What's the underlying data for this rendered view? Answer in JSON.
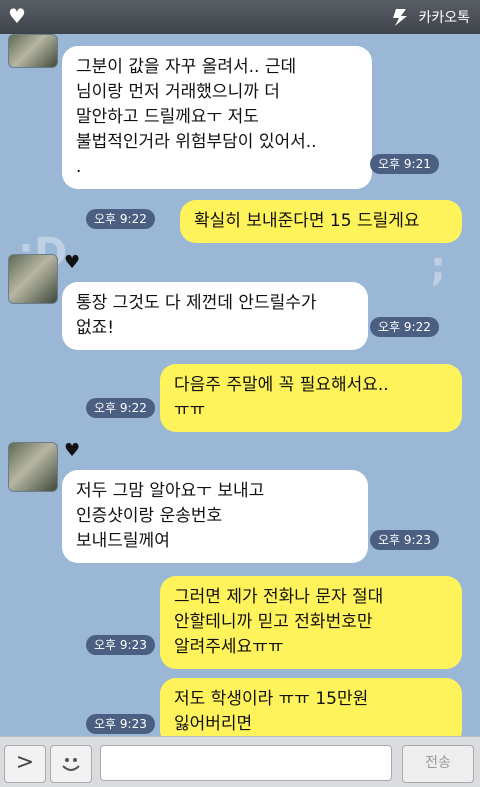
{
  "app": {
    "brand": "카카오톡"
  },
  "messages": [
    {
      "text": "그분이 값을 자꾸 올려서.. 근데\n님이랑 먼저 거래했으니까 더\n말안하고 드릴께요ㅜ 저도\n불법적인거라 위험부담이 있어서..\n.",
      "time": "오후 9:21"
    },
    {
      "text": "확실히 보내준다면 15 드릴게요",
      "time": "오후 9:22"
    },
    {
      "text": "통장 그것도 다 제껀데 안드릴수가\n없죠!",
      "time": "오후 9:22"
    },
    {
      "text": "다음주 주말에 꼭 필요해서요..\nㅠㅠ",
      "time": "오후 9:22"
    },
    {
      "text": "저두 그맘 알아요ㅜ 보내고\n인증샷이랑 운송번호\n보내드릴께여",
      "time": "오후 9:23"
    },
    {
      "text": "그러면 제가 전화나 문자 절대\n안할테니까 믿고 전화번호만\n알려주세요ㅠㅠ",
      "time": "오후 9:23"
    },
    {
      "text": "저도 학생이라 ㅠㅠ 15만원\n잃어버리면",
      "time": "오후 9:23"
    }
  ],
  "input": {
    "send_label": "전송"
  },
  "icons": [
    "heart-icon",
    "kakao-logo-icon",
    "chevron-right-icon",
    "smiley-icon"
  ],
  "colors": {
    "chat_bg": "#9bb7d6",
    "my_bubble": "#fff35c",
    "their_bubble": "#ffffff"
  }
}
